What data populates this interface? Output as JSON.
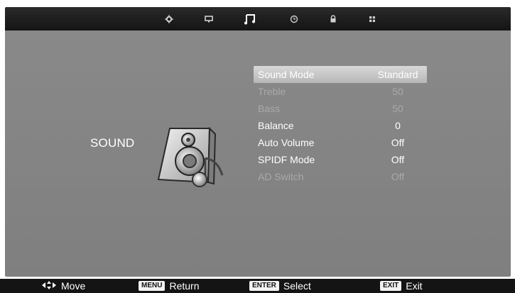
{
  "top_tabs": [
    {
      "name": "tab-picture",
      "icon": "gear-icon",
      "active": false
    },
    {
      "name": "tab-screen",
      "icon": "monitor-icon",
      "active": false
    },
    {
      "name": "tab-sound",
      "icon": "music-note-icon",
      "active": true
    },
    {
      "name": "tab-time",
      "icon": "clock-icon",
      "active": false
    },
    {
      "name": "tab-lock",
      "icon": "lock-icon",
      "active": false
    },
    {
      "name": "tab-setup",
      "icon": "grid-icon",
      "active": false
    }
  ],
  "section": {
    "title": "SOUND",
    "icon": "speaker-icon"
  },
  "menu": {
    "items": [
      {
        "label": "Sound Mode",
        "value": "Standard",
        "state": "selected"
      },
      {
        "label": "Treble",
        "value": "50",
        "state": "disabled"
      },
      {
        "label": "Bass",
        "value": "50",
        "state": "disabled"
      },
      {
        "label": "Balance",
        "value": "0",
        "state": "normal"
      },
      {
        "label": "Auto Volume",
        "value": "Off",
        "state": "normal"
      },
      {
        "label": "SPIDF Mode",
        "value": "Off",
        "state": "normal"
      },
      {
        "label": "AD Switch",
        "value": "Off",
        "state": "disabled"
      }
    ]
  },
  "bottom_hints": [
    {
      "key_icon": "dpad-icon",
      "label": "Move"
    },
    {
      "key": "MENU",
      "label": "Return"
    },
    {
      "key": "ENTER",
      "label": "Select"
    },
    {
      "key": "EXIT",
      "label": "Exit"
    }
  ],
  "colors": {
    "background": "#808080",
    "bars": "#141414",
    "text": "#ffffff",
    "disabled_text": "#a9a9a9",
    "selected_row": "#c8c8c8"
  }
}
